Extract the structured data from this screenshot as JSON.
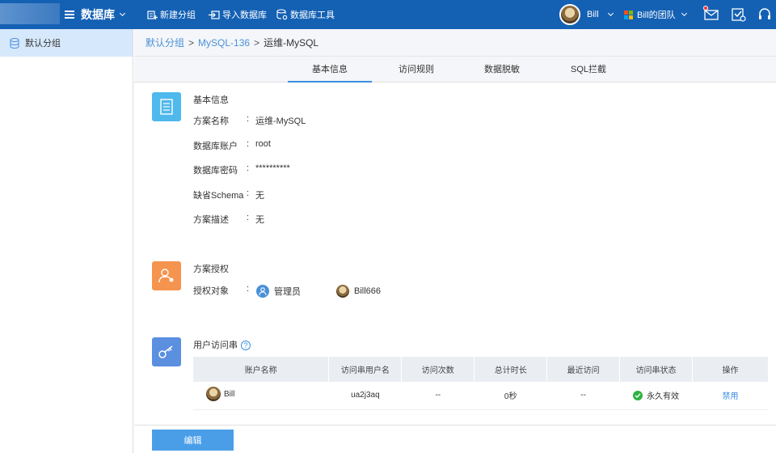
{
  "header": {
    "app_title": "数据库",
    "actions": [
      {
        "label": "新建分组",
        "icon": "new-group-icon"
      },
      {
        "label": "导入数据库",
        "icon": "import-icon"
      },
      {
        "label": "数据库工具",
        "icon": "tools-icon"
      }
    ],
    "user_name": "Bill",
    "team_name": "Bill的团队",
    "colors": {
      "bar": "#1461b4",
      "accent": "#3b8ee0"
    }
  },
  "sidebar": {
    "items": [
      {
        "label": "默认分组",
        "icon": "database-icon"
      }
    ]
  },
  "breadcrumb": {
    "items": [
      "默认分组",
      "MySQL-136",
      "运维-MySQL"
    ],
    "separator": ">"
  },
  "tabs": [
    {
      "label": "基本信息",
      "active": true
    },
    {
      "label": "访问规则",
      "active": false
    },
    {
      "label": "数据脱敏",
      "active": false
    },
    {
      "label": "SQL拦截",
      "active": false
    }
  ],
  "basic_info": {
    "title": "基本信息",
    "fields": [
      {
        "label": "方案名称",
        "value": "运维-MySQL"
      },
      {
        "label": "数据库账户",
        "value": "root"
      },
      {
        "label": "数据库密码",
        "value": "**********"
      },
      {
        "label": "缺省Schema",
        "value": "无"
      },
      {
        "label": "方案描述",
        "value": "无"
      }
    ]
  },
  "authorization": {
    "title": "方案授权",
    "label": "授权对象",
    "subjects": [
      {
        "name": "管理员",
        "icon": "admin-group-icon"
      },
      {
        "name": "Bill666",
        "icon": "user-avatar"
      }
    ]
  },
  "access_strings": {
    "title": "用户访问串",
    "help": "?",
    "columns": [
      "账户名称",
      "访问串用户名",
      "访问次数",
      "总计时长",
      "最近访问",
      "访问串状态",
      "操作"
    ],
    "rows": [
      {
        "account": "Bill",
        "username": "ua2j3aq",
        "count": "--",
        "duration": "0秒",
        "last": "--",
        "status": "永久有效",
        "action": "禁用"
      }
    ]
  },
  "footer": {
    "edit_label": "编辑"
  }
}
